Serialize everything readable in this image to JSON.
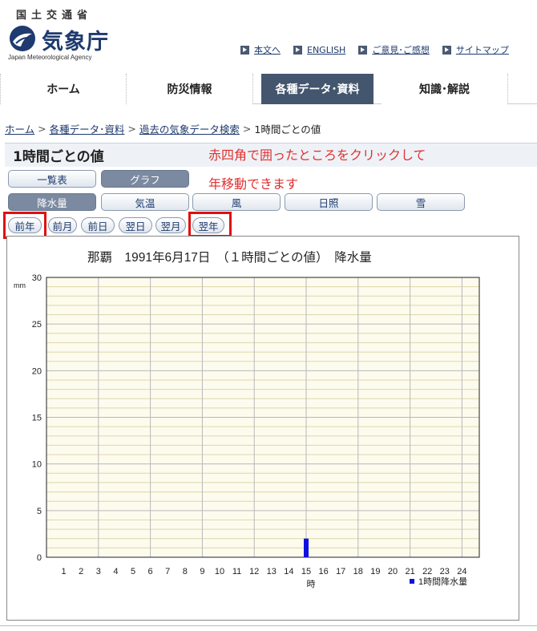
{
  "header": {
    "ministry": "国土交通省",
    "agency_name": "気象庁",
    "agency_english": "Japan Meteorological Agency",
    "util_links": [
      "本文へ",
      "ENGLISH",
      "ご意見･ご感想",
      "サイトマップ"
    ]
  },
  "nav": {
    "items": [
      "ホーム",
      "防災情報",
      "各種データ･資料",
      "知識･解説"
    ],
    "active_index": 2
  },
  "breadcrumb": {
    "links": [
      "ホーム",
      "各種データ･資料",
      "過去の気象データ検索"
    ],
    "current": "1時間ごとの値",
    "separator": ">"
  },
  "page": {
    "title": "1時間ごとの値",
    "annotation_line1": "赤四角で囲ったところをクリックして",
    "annotation_line2": "年移動できます"
  },
  "view_tabs": {
    "list": "一覧表",
    "graph": "グラフ",
    "active": "graph"
  },
  "element_tabs": {
    "items": [
      "降水量",
      "気温",
      "風",
      "日照",
      "雪"
    ],
    "active_index": 0
  },
  "date_nav": {
    "prev_year": "前年",
    "prev_month": "前月",
    "prev_day": "前日",
    "next_day": "翌日",
    "next_month": "翌月",
    "next_year": "翌年"
  },
  "colors": {
    "bar": "#1010e0",
    "highlight": "#e01010",
    "nav_active": "#43566e",
    "annotation": "#e03030"
  },
  "chart_data": {
    "type": "bar",
    "title": "那覇　1991年6月17日　（１時間ごとの値）　降水量",
    "ylabel": "mm",
    "xlabel": "時",
    "ylim": [
      0,
      30
    ],
    "yticks": [
      0,
      5,
      10,
      15,
      20,
      25,
      30
    ],
    "categories": [
      "1",
      "2",
      "3",
      "4",
      "5",
      "6",
      "7",
      "8",
      "9",
      "10",
      "11",
      "12",
      "13",
      "14",
      "15",
      "16",
      "17",
      "18",
      "19",
      "20",
      "21",
      "22",
      "23",
      "24"
    ],
    "series": [
      {
        "name": "1時間降水量",
        "values": [
          0,
          0,
          0,
          0,
          0,
          0,
          0,
          0,
          0,
          0,
          0,
          0,
          0,
          0,
          2,
          0,
          0,
          0,
          0,
          0,
          0,
          0,
          0,
          0
        ]
      }
    ],
    "grid": true,
    "legend": "bottom-right"
  }
}
